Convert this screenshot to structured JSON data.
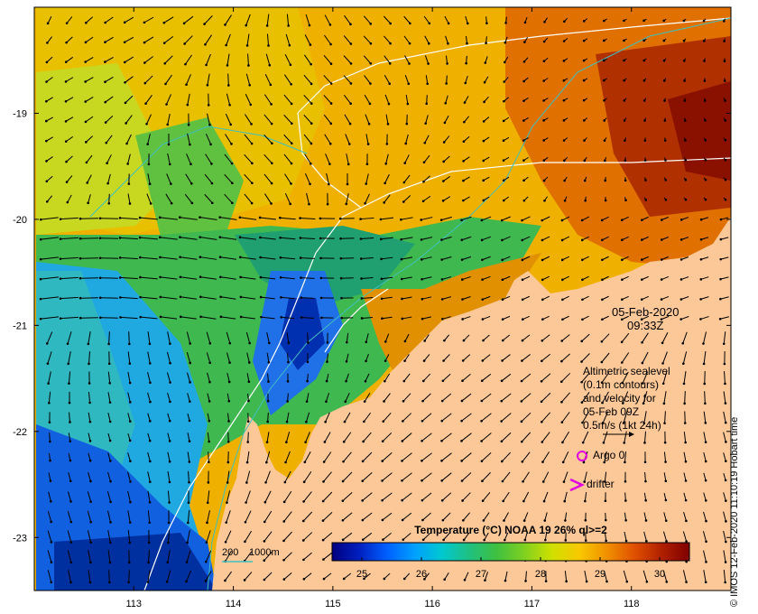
{
  "map": {
    "lon_ticks": [
      "113",
      "114",
      "115",
      "116",
      "117",
      "118"
    ],
    "lat_ticks": [
      "-19",
      "-20",
      "-21",
      "-22",
      "-23"
    ],
    "lon_range": [
      112.0,
      119.0
    ],
    "lat_range": [
      -23.5,
      -18.0
    ]
  },
  "timestamp": {
    "date": "05-Feb-2020",
    "time": "09:33Z"
  },
  "legend": {
    "lines": [
      "Altimetric sealevel",
      "(0.1m contours)",
      "and velocity for",
      "05-Feb 09Z",
      "0.5m/s (1kt 24h)"
    ],
    "argo_label": "Argo 0",
    "drifter_label": "drifter",
    "argo_color": "#e000e0",
    "drifter_color": "#e000e0"
  },
  "bathymetry_legend": {
    "label_200": "200",
    "label_1000": "1000m",
    "color": "#40c0c0"
  },
  "colorbar": {
    "title": "Temperature (°C) NOAA 19 26% ql>=2",
    "ticks": [
      "25",
      "26",
      "27",
      "28",
      "29",
      "30"
    ],
    "range": [
      24.5,
      30.5
    ],
    "colors": [
      "#00007f",
      "#0020c0",
      "#0060ff",
      "#00a0ff",
      "#00c8d0",
      "#20c080",
      "#40c040",
      "#80d020",
      "#d0e000",
      "#f8c800",
      "#f09000",
      "#e05000",
      "#b02000",
      "#7f0000"
    ]
  },
  "credit": "© IMOS 12-Feb-2020 11:10:19 Hobart time",
  "colors": {
    "land": "#fcc898",
    "frame": "#000000"
  }
}
